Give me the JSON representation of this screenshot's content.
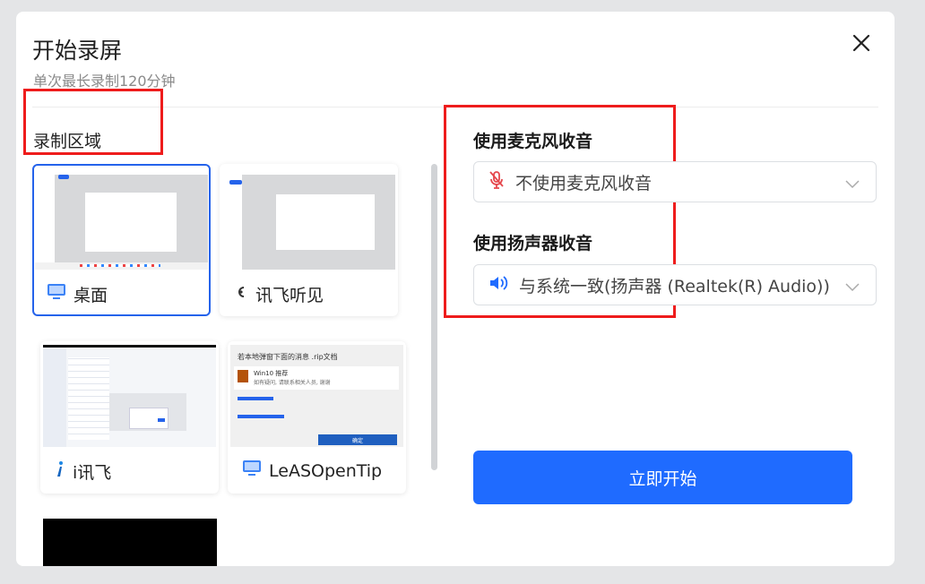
{
  "dialog": {
    "title": "开始录屏",
    "subtitle": "单次最长录制120分钟",
    "close_icon": "close-icon"
  },
  "region": {
    "label": "录制区域",
    "sources": [
      {
        "label": "桌面",
        "icon": "monitor-icon",
        "selected": true
      },
      {
        "label": "讯飞听见",
        "icon": "xunfei-tingjian-icon",
        "selected": false
      },
      {
        "label": "i讯飞",
        "icon": "ixunfei-icon",
        "selected": false
      },
      {
        "label": "LeASOpenTip",
        "icon": "monitor-icon",
        "selected": false
      }
    ]
  },
  "thumbnail_text": {
    "leasopentip_title": "若本地弹窗下面的消息 .rip文档",
    "leasopentip_item": "Win10 推荐",
    "leasopentip_desc": "如有疑问, 请联系相关人员, 谢谢",
    "leasopentip_button": "确定"
  },
  "microphone": {
    "label": "使用麦克风收音",
    "value": "不使用麦克风收音",
    "icon": "mic-off-icon"
  },
  "speaker": {
    "label": "使用扬声器收音",
    "value": "与系统一致(扬声器 (Realtek(R) Audio))",
    "icon": "speaker-icon"
  },
  "start_button": {
    "label": "立即开始"
  },
  "colors": {
    "accent": "#1f6bff",
    "highlight": "#ee1c1c",
    "mic_off": "#e5484d"
  }
}
